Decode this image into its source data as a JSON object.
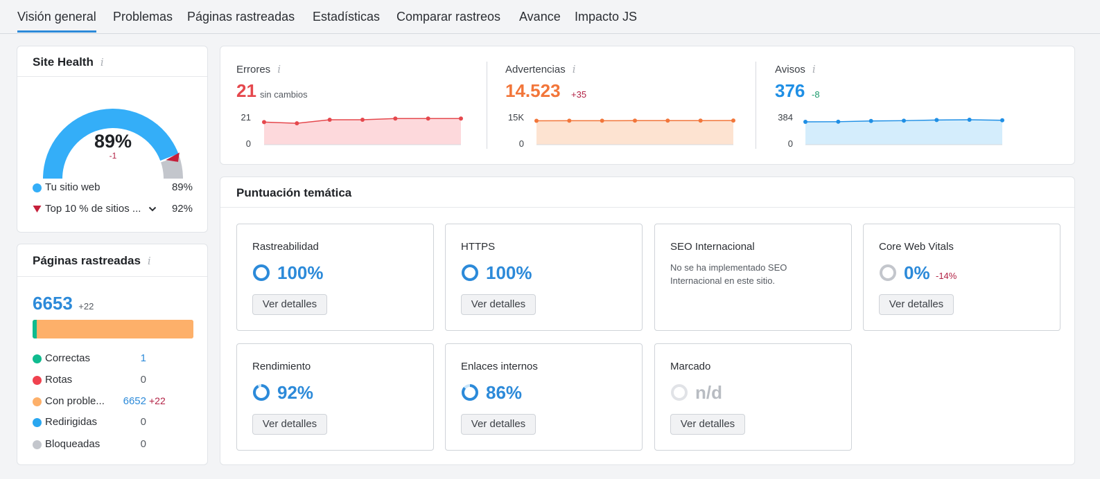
{
  "tabs": [
    {
      "label": "Visión general",
      "active": true
    },
    {
      "label": "Problemas"
    },
    {
      "label": "Páginas rastreadas"
    },
    {
      "label": "Estadísticas"
    },
    {
      "label": "Comparar rastreos"
    },
    {
      "label": "Avance"
    },
    {
      "label": "Impacto JS"
    }
  ],
  "site_health": {
    "title": "Site Health",
    "info_icon": "i",
    "value": "89%",
    "value_fraction": 0.89,
    "delta": "-1",
    "legend": [
      {
        "label": "Tu sitio web",
        "value": "89%",
        "color": "#34aef8"
      },
      {
        "label": "Top 10 % de sitios ...",
        "value": "92%",
        "color": "#c51f3a"
      }
    ],
    "chevron": "chevron-down-icon"
  },
  "crawled": {
    "title": "Páginas rastreadas",
    "info_icon": "i",
    "total": "6653",
    "delta": "+22",
    "bar": {
      "correctas": 1,
      "con_problemas": 6652
    },
    "items": [
      {
        "label": "Correctas",
        "value": "1",
        "delta": "",
        "color": "#0fbb8f"
      },
      {
        "label": "Rotas",
        "value": "0",
        "delta": "",
        "color": "#f0424f"
      },
      {
        "label": "Con proble...",
        "value": "6652",
        "delta": "+22",
        "color": "#fdb06a"
      },
      {
        "label": "Redirigidas",
        "value": "0",
        "delta": "",
        "color": "#2aa7f0"
      },
      {
        "label": "Bloqueadas",
        "value": "0",
        "delta": "",
        "color": "#c3c6cc"
      }
    ]
  },
  "metrics": [
    {
      "label": "Errores",
      "info_icon": "i",
      "value": "21",
      "delta": "sin cambios",
      "color": "#e5484d",
      "delta_color": "#555a61",
      "fill": "#fdd9dc",
      "ymax_label": "21",
      "ymin_label": "0",
      "ymax": 21,
      "points": [
        19,
        18,
        21,
        21,
        22,
        22,
        22
      ]
    },
    {
      "label": "Advertencias",
      "info_icon": "i",
      "value": "14.523",
      "delta": "+35",
      "color": "#f2763a",
      "delta_color": "#b22144",
      "fill": "#fde3d1",
      "ymax_label": "15K",
      "ymin_label": "0",
      "ymax": 15000,
      "points": [
        14380,
        14410,
        14440,
        14460,
        14470,
        14488,
        14523
      ]
    },
    {
      "label": "Avisos",
      "info_icon": "i",
      "value": "376",
      "delta": "-8",
      "color": "#1f8fe5",
      "delta_color": "#1a9a6b",
      "fill": "#d4edfc",
      "ymax_label": "384",
      "ymin_label": "0",
      "ymax": 384,
      "points": [
        352,
        354,
        365,
        370,
        380,
        384,
        376
      ]
    }
  ],
  "thematic": {
    "title": "Puntuación temática",
    "cards": [
      {
        "title": "Rastreabilidad",
        "value": "100%",
        "fraction": 1.0,
        "delta": "",
        "button": "Ver detalles",
        "state": "ok"
      },
      {
        "title": "HTTPS",
        "value": "100%",
        "fraction": 1.0,
        "delta": "",
        "button": "Ver detalles",
        "state": "ok"
      },
      {
        "title": "SEO Internacional",
        "note": "No se ha implementado SEO Internacional en este sitio.",
        "state": "note"
      },
      {
        "title": "Core Web Vitals",
        "value": "0%",
        "fraction": 0,
        "delta": "-14%",
        "button": "Ver detalles",
        "state": "ok"
      },
      {
        "title": "Rendimiento",
        "value": "92%",
        "fraction": 0.92,
        "delta": "",
        "button": "Ver detalles",
        "state": "ok"
      },
      {
        "title": "Enlaces internos",
        "value": "86%",
        "fraction": 0.86,
        "delta": "",
        "button": "Ver detalles",
        "state": "ok"
      },
      {
        "title": "Marcado",
        "value": "n/d",
        "fraction": 0,
        "delta": "",
        "button": "Ver detalles",
        "state": "na"
      }
    ]
  },
  "colors": {
    "accent": "#2c8ad9",
    "negative": "#b22144"
  }
}
